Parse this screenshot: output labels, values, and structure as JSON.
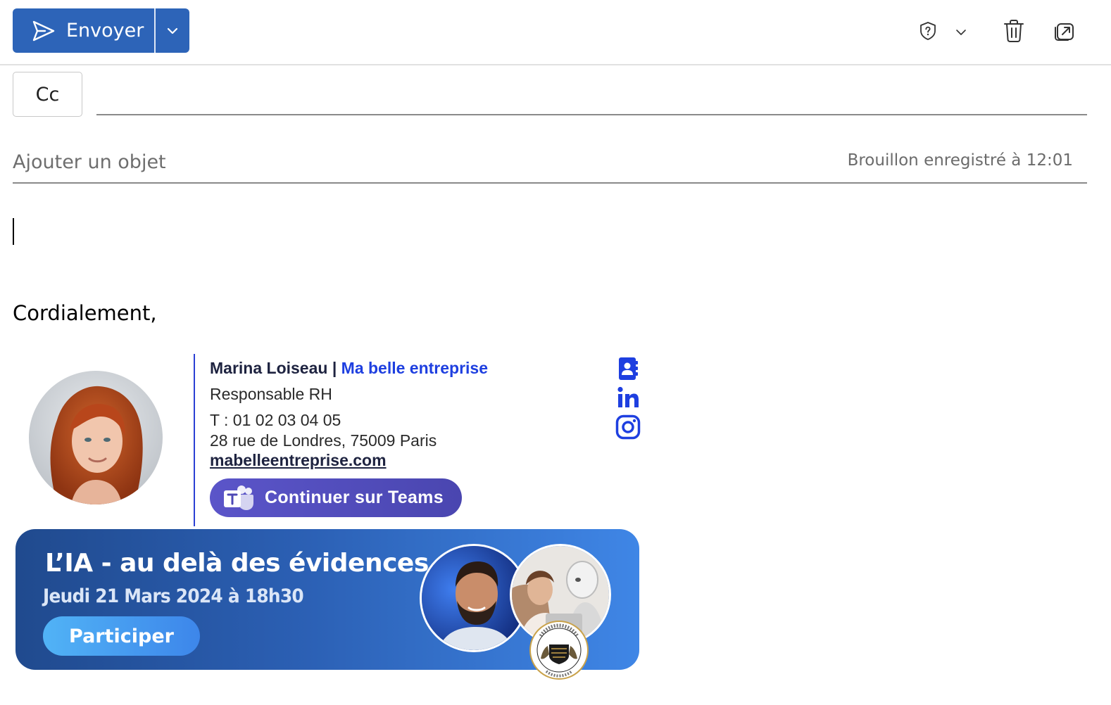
{
  "toolbar": {
    "send_label": "Envoyer",
    "accent": "#2d64b8",
    "icons": [
      "send-icon",
      "chevron-down-icon",
      "shield-question-icon",
      "chevron-down-icon",
      "trash-icon",
      "pop-out-icon"
    ]
  },
  "compose": {
    "cc_label": "Cc",
    "cc_value": "",
    "subject_placeholder": "Ajouter un objet",
    "subject_value": "",
    "draft_status": "Brouillon enregistré à 12:01",
    "closing": "Cordialement,"
  },
  "signature": {
    "name": "Marina Loiseau",
    "separator": " | ",
    "company": "Ma belle entreprise",
    "role": "Responsable RH",
    "phone": "T : 01 02 03 04 05",
    "address": "28 rue de Londres, 75009 Paris",
    "website": "mabelleentreprise.com",
    "teams_label": "Continuer sur Teams",
    "social_icons": [
      "contact-book-icon",
      "linkedin-icon",
      "instagram-icon"
    ],
    "accent": "#1e3fe0"
  },
  "banner": {
    "title": "L’IA - au delà des évidences",
    "date": "Jeudi 21 Mars 2024 à 18h30",
    "cta": "Participer"
  }
}
